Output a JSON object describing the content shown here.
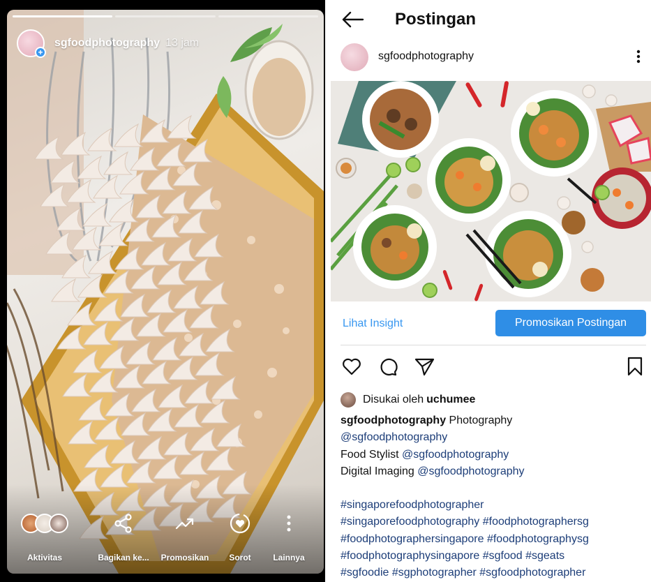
{
  "story": {
    "username": "sgfoodphotography",
    "time": "13 jam",
    "progress": [
      1.0,
      0.0,
      0.0
    ],
    "actions": [
      {
        "label": "Aktivitas",
        "icon": "viewer-avatars"
      },
      {
        "label": "Bagikan ke...",
        "icon": "share-icon"
      },
      {
        "label": "Promosikan",
        "icon": "trending-up-icon"
      },
      {
        "label": "Sorot",
        "icon": "highlight-heart-icon"
      },
      {
        "label": "Lainnya",
        "icon": "more-vertical-icon"
      }
    ]
  },
  "post": {
    "title": "Postingan",
    "author": "sgfoodphotography",
    "insight_link": "Lihat Insight",
    "promote_button": "Promosikan Postingan",
    "liked_by_prefix": "Disukai oleh",
    "liked_by_user": "uchumee",
    "caption": {
      "username": "sgfoodphotography",
      "line1_rest": "Photography",
      "line2": "@sgfoodphotography",
      "line3_prefix": "Food Stylist",
      "line3_tag": "@sgfoodphotography",
      "line4_prefix": "Digital Imaging",
      "line4_tag": "@sgfoodphotography",
      "hashtags": [
        "#singaporefoodphotographer",
        "#singaporefoodphotography #foodphotographersg",
        "#foodphotographersingapore #foodphotographysg",
        "#foodphotographysingapore #sgfood #sgeats",
        "#sgfoodie #sgphotographer #sgfoodphotographer"
      ]
    }
  },
  "colors": {
    "accent": "#3897f0",
    "button": "#2f8ee6",
    "hashtag": "#1c3d78",
    "story_bg": "#000000"
  }
}
